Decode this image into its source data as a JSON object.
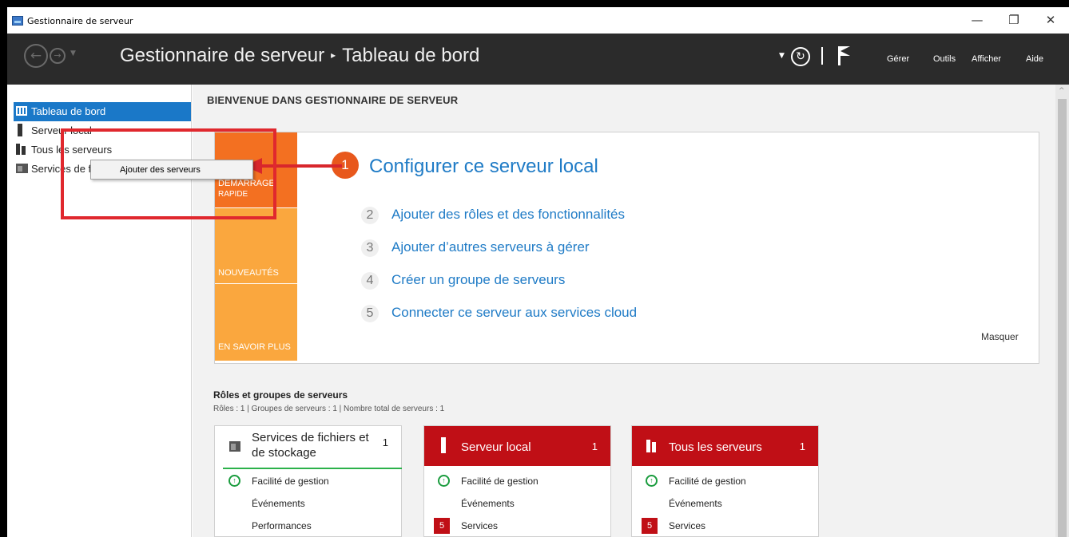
{
  "window": {
    "title": "Gestionnaire de serveur",
    "minimize": "—",
    "restore": "❐",
    "close": "✕"
  },
  "header": {
    "breadcrumb_root": "Gestionnaire de serveur",
    "breadcrumb_separator": "▸",
    "breadcrumb_current": "Tableau de bord",
    "menus": [
      "Gérer",
      "Outils",
      "Afficher",
      "Aide"
    ]
  },
  "sidebar": {
    "items": [
      {
        "label": "Tableau de bord",
        "icon": "dashboard-icon",
        "active": true
      },
      {
        "label": "Serveur local",
        "icon": "server-icon"
      },
      {
        "label": "Tous les serveurs",
        "icon": "servers-icon"
      },
      {
        "label": "Services de fichiers et de stockage",
        "icon": "file-services-icon"
      }
    ]
  },
  "context_menu": {
    "item": "Ajouter des serveurs"
  },
  "welcome": {
    "title": "BIENVENUE DANS GESTIONNAIRE DE SERVEUR",
    "tiles": [
      {
        "line1": "DÉMARRAGE",
        "line2": "RAPIDE",
        "color": "#f37021"
      },
      {
        "line1": "NOUVEAUTÉS",
        "color": "#faa73e"
      },
      {
        "line1": "EN SAVOIR PLUS",
        "color": "#faa73e"
      }
    ],
    "steps": [
      {
        "num": "1",
        "label": "Configurer ce serveur local"
      },
      {
        "num": "2",
        "label": "Ajouter des rôles et des fonctionnalités"
      },
      {
        "num": "3",
        "label": "Ajouter d’autres serveurs à gérer"
      },
      {
        "num": "4",
        "label": "Créer un groupe de serveurs"
      },
      {
        "num": "5",
        "label": "Connecter ce serveur aux services cloud"
      }
    ],
    "hide": "Masquer"
  },
  "roles": {
    "title": "Rôles et groupes de serveurs",
    "summary": "Rôles : 1  |  Groupes de serveurs : 1  |  Nombre total de serveurs : 1",
    "tiles": [
      {
        "name": "Services de fichiers et de stockage",
        "name_line1": "Services de fichiers et",
        "name_line2": "de stockage",
        "count": "1",
        "rows": [
          "Facilité de gestion",
          "Événements",
          "Performances"
        ]
      },
      {
        "name": "Serveur local",
        "count": "1",
        "rows": [
          "Facilité de gestion",
          "Événements",
          "Services"
        ],
        "services_badge": "5"
      },
      {
        "name": "Tous les serveurs",
        "count": "1",
        "rows": [
          "Facilité de gestion",
          "Événements",
          "Services"
        ],
        "services_badge": "5"
      }
    ]
  },
  "colors": {
    "header_bg": "#2b2b2b",
    "sidebar_active": "#1a78c8",
    "link_blue": "#1f7bc6",
    "tile_red": "#c00f16",
    "quick_start_orange": "#f37021",
    "tile_orange": "#faa73e",
    "annotation_red": "#e0282e"
  }
}
